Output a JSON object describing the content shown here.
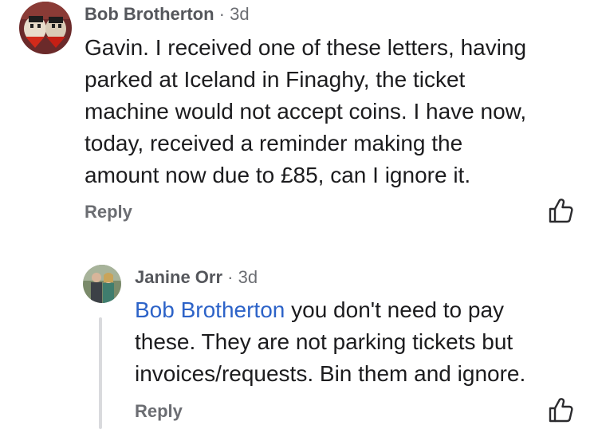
{
  "comments": [
    {
      "author": "Bob Brotherton",
      "separator": "·",
      "age": "3d",
      "lines": [
        "Gavin. I received one of these letters, having",
        "parked at Iceland in Finaghy, the ticket",
        "machine would not accept coins.  I have now,",
        "today, received a reminder making the",
        "amount now due to £85, can I ignore it."
      ],
      "reply_label": "Reply",
      "like_icon": "thumbs-up-outline-icon"
    },
    {
      "author": "Janine Orr",
      "separator": "·",
      "age": "3d",
      "mention": "Bob Brotherton",
      "lines": [
        " you don't need to pay",
        "these. They are not parking tickets but",
        "invoices/requests. Bin them and ignore."
      ],
      "reply_label": "Reply",
      "like_icon": "thumbs-up-outline-icon"
    }
  ],
  "colors": {
    "mention": "#2d63c8",
    "meta": "#6b6d72",
    "thread_line": "#d9dadd"
  }
}
